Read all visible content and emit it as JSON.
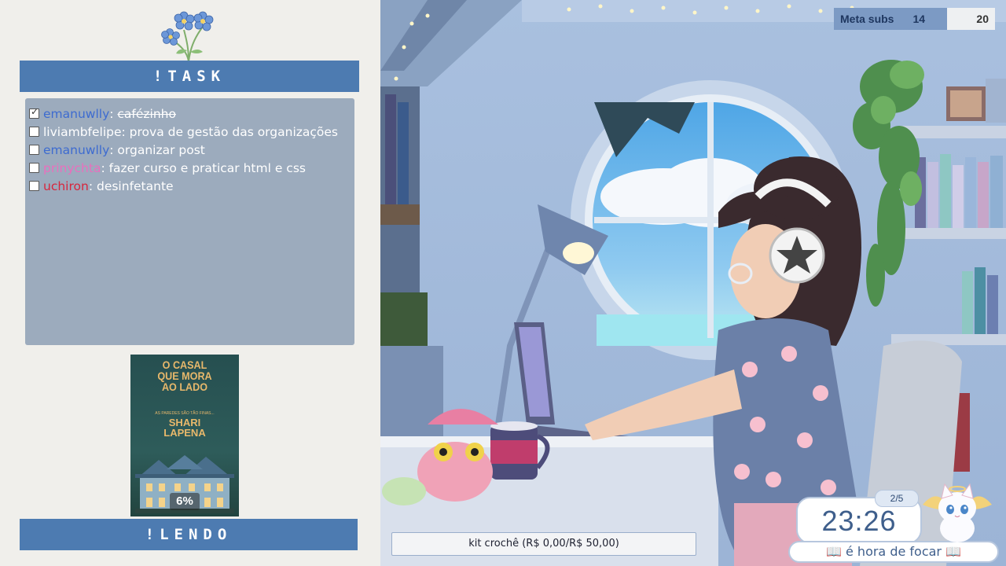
{
  "task_panel": {
    "header": "!TASK",
    "items": [
      {
        "user": "emanuwlly",
        "user_color": "#3d6bd0",
        "sep": ": ",
        "text": "cafézinho",
        "done": true
      },
      {
        "user": "liviambfelipe",
        "user_color": "#ffffff",
        "sep": ": ",
        "text": "prova de gestão das organizações",
        "done": false
      },
      {
        "user": "emanuwlly",
        "user_color": "#3d6bd0",
        "sep": ": ",
        "text": "organizar post",
        "done": false
      },
      {
        "user": "prinychta",
        "user_color": "#ea6fbd",
        "sep": ": ",
        "text": "fazer curso e praticar html e css",
        "done": false
      },
      {
        "user": "uchiron",
        "user_color": "#d7263d",
        "sep": ": ",
        "text": "desinfetante",
        "done": false
      }
    ]
  },
  "reading_panel": {
    "header": "!LENDO",
    "book": {
      "title_lines": [
        "O CASAL",
        "QUE MORA",
        "AO LADO"
      ],
      "subtitle": "AS PAREDES SÃO TÃO FINAS...",
      "author_lines": [
        "SHARI",
        "LAPENA"
      ],
      "progress": "6%"
    }
  },
  "sub_goal": {
    "label": "Meta subs",
    "current": "14",
    "goal": "20",
    "fill_fraction": 0.7
  },
  "donation_goal": {
    "text": "kit crochê (R$ 0,00/R$ 50,00)"
  },
  "timer": {
    "count": "2/5",
    "time": "23:26",
    "message": "📖 é hora de focar 📖"
  },
  "icons": [
    "flower-icon",
    "checkbox-icon",
    "book-cover",
    "cat-mascot",
    "book-icon"
  ],
  "colors": {
    "accent_blue": "#4d7bb1",
    "task_box": "#9cabbd",
    "panel_bg": "#f0efeb"
  }
}
